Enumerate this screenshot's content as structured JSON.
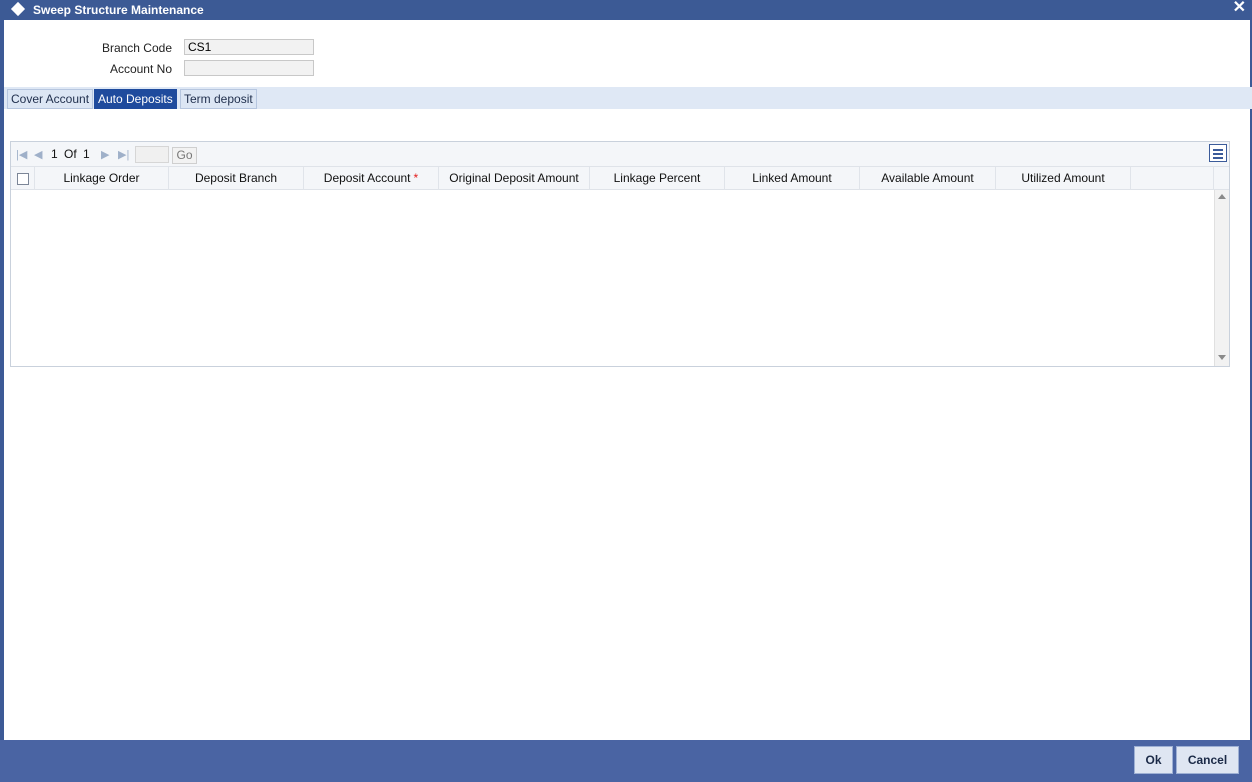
{
  "window": {
    "title": "Sweep Structure Maintenance",
    "close_glyph": "✕"
  },
  "header": {
    "branch_code_label": "Branch Code",
    "branch_code_value": "CS1",
    "account_no_label": "Account No",
    "account_no_value": ""
  },
  "tabs": [
    {
      "label": "Cover Account",
      "active": false
    },
    {
      "label": "Auto Deposits",
      "active": true
    },
    {
      "label": "Term deposit",
      "active": false
    }
  ],
  "grid": {
    "pagination": {
      "current": "1",
      "of_label": "Of",
      "total": "1",
      "go_label": "Go",
      "page_input": ""
    },
    "columns": [
      "Linkage Order",
      "Deposit Branch",
      "Deposit Account",
      "Original Deposit Amount",
      "Linkage Percent",
      "Linked Amount",
      "Available Amount",
      "Utilized Amount"
    ],
    "required_marker": "*",
    "rows": []
  },
  "footer": {
    "ok_label": "Ok",
    "cancel_label": "Cancel"
  },
  "colors": {
    "title_bar": "#3c5a95",
    "active_tab": "#1f4b9d",
    "footer": "#4a64a3"
  }
}
